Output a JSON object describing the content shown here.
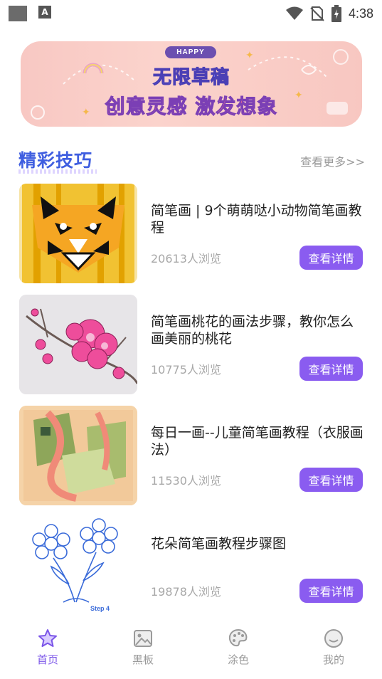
{
  "status_bar": {
    "app_glyph": "A",
    "time": "4:38"
  },
  "banner": {
    "badge": "HAPPY",
    "line1": "无限草稿",
    "line2": "创意灵感 激发想象"
  },
  "section": {
    "title": "精彩技巧",
    "see_more": "查看更多>>"
  },
  "articles": [
    {
      "title": "简笔画 | 9个萌萌哒小动物简笔画教程",
      "views": "20613人浏览",
      "button": "查看详情",
      "image": "tiger-illustration"
    },
    {
      "title": "简笔画桃花的画法步骤，教你怎么画美丽的桃花",
      "views": "10775人浏览",
      "button": "查看详情",
      "image": "peach-blossom-illustration"
    },
    {
      "title": "每日一画--儿童简笔画教程（衣服画法）",
      "views": "11530人浏览",
      "button": "查看详情",
      "image": "clothes-illustration"
    },
    {
      "title": "花朵简笔画教程步骤图",
      "views": "19878人浏览",
      "button": "查看详情",
      "image": "flower-sketch-illustration",
      "image_caption": "Step 4"
    }
  ],
  "bottom_nav": [
    {
      "label": "首页",
      "icon": "star-icon",
      "active": true
    },
    {
      "label": "黑板",
      "icon": "image-board-icon",
      "active": false
    },
    {
      "label": "涂色",
      "icon": "palette-icon",
      "active": false
    },
    {
      "label": "我的",
      "icon": "profile-icon",
      "active": false
    }
  ],
  "colors": {
    "accent": "#8a5cf0",
    "section_title": "#3f5ee0",
    "banner_bg": "#f8c8c3"
  }
}
